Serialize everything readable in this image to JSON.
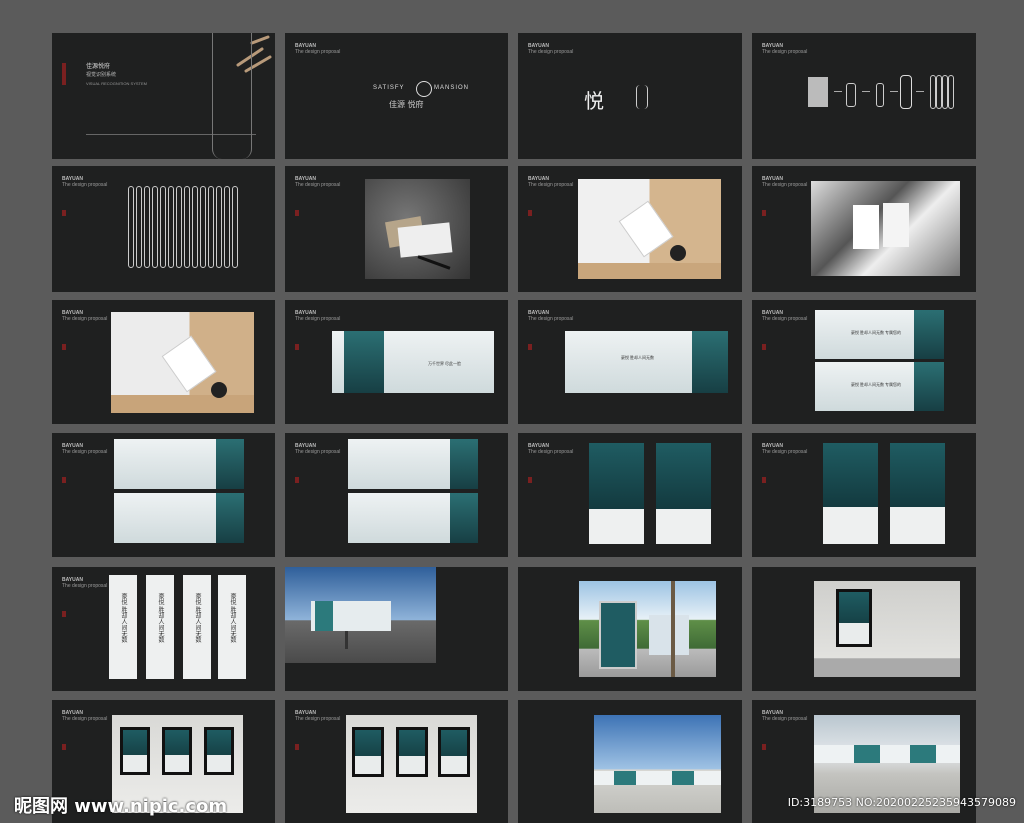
{
  "brand": {
    "name_line": "BAYUAN",
    "sub_line": "The design proposal"
  },
  "cover": {
    "title_cn": "佳源悦府",
    "subtitle_cn": "视觉识别系统",
    "subtitle_en": "VISUAL RECOGNITION SYSTEM"
  },
  "logo_slide": {
    "en_left": "SATISFY",
    "en_right": "MANSION",
    "cn": "佳源  悦府"
  },
  "glyph_slide": {
    "char": "悦"
  },
  "banner_texts": {
    "a": "万千世界  尽此一脸",
    "b": "豪悦  胜却人间无数",
    "c": "豪悦  胜却人间无数  专属您的"
  },
  "vertical_text": "豪悦  胜却人间无数",
  "watermark": {
    "left": "昵图网 www.nipic.com",
    "right": "ID:3189753 NO:20200225235943579089"
  },
  "colors": {
    "page_bg": "#5b5b5b",
    "slide_bg": "#1f2020",
    "teal": "#2c7a7c",
    "seal_red": "#7a2020"
  }
}
